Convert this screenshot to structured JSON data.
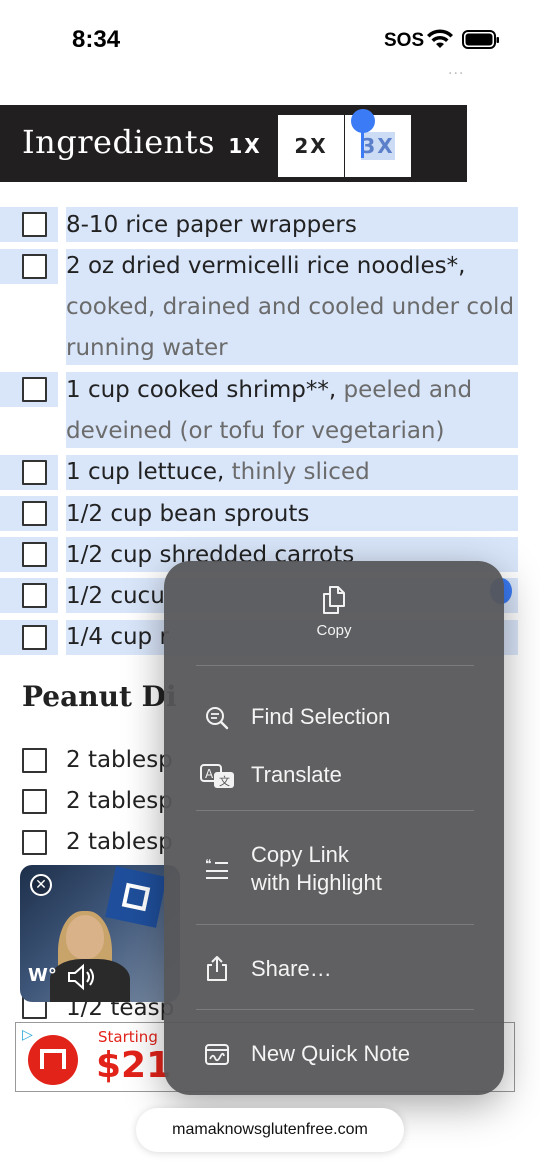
{
  "status_bar": {
    "time": "8:34",
    "carrier": "SOS"
  },
  "ingredients_header": {
    "title": "Ingredients",
    "multipliers": [
      "1X",
      "2X",
      "3X"
    ]
  },
  "ingredients": [
    {
      "main": "8-10 rice paper wrappers",
      "note": ""
    },
    {
      "main": "2 oz dried vermicelli rice noodles*,",
      "note": " cooked, drained and cooled under cold running water"
    },
    {
      "main": "1 cup cooked shrimp**,",
      "note": " peeled and deveined (or tofu for vegetarian)"
    },
    {
      "main": "1 cup lettuce,",
      "note": " thinly sliced"
    },
    {
      "main": "1/2 cup bean sprouts",
      "note": ""
    },
    {
      "main": "1/2 cup shredded carrots",
      "note": ""
    },
    {
      "main": "1/2 cucu",
      "note": ""
    },
    {
      "main": "1/4 cup r",
      "note": ""
    }
  ],
  "peanut_section": {
    "title": "Peanut Di",
    "items": [
      "2 tablesp",
      "2 tablesp",
      "2 tablesp",
      "1/2 teasp"
    ]
  },
  "video_ad": {
    "brand": "W°"
  },
  "banner_ad": {
    "starting_text": "Starting",
    "price": "$21"
  },
  "context_menu": {
    "copy_label": "Copy",
    "items": [
      {
        "label": "Find Selection",
        "icon": "find-selection-icon"
      },
      {
        "label": "Translate",
        "icon": "translate-icon"
      },
      {
        "label": "Copy Link with Highlight",
        "line1": "Copy Link",
        "line2": "with Highlight",
        "icon": "copy-link-highlight-icon"
      },
      {
        "label": "Share…",
        "icon": "share-icon"
      },
      {
        "label": "New Quick Note",
        "icon": "quick-note-icon"
      }
    ]
  },
  "url_bar": {
    "domain": "mamaknowsglutenfree.com"
  },
  "colors": {
    "header_bg": "#221f20",
    "selection_highlight": "#d9e6fa",
    "selection_accent": "#3b7cf6",
    "menu_bg": "#565658"
  }
}
